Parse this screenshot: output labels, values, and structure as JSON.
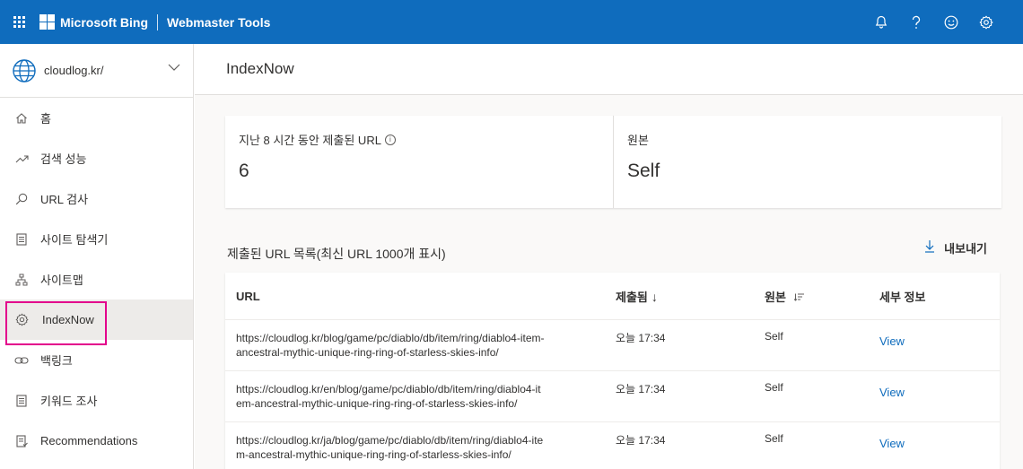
{
  "topbar": {
    "brand": "Microsoft Bing",
    "product": "Webmaster Tools",
    "icons": [
      "bell-icon",
      "help-icon",
      "smiley-icon",
      "settings-icon"
    ]
  },
  "sidebar": {
    "site": "cloudlog.kr/",
    "items": [
      {
        "label": "홈",
        "icon": "home-icon"
      },
      {
        "label": "검색 성능",
        "icon": "trend-icon"
      },
      {
        "label": "URL 검사",
        "icon": "search-icon"
      },
      {
        "label": "사이트 탐색기",
        "icon": "document-icon"
      },
      {
        "label": "사이트맵",
        "icon": "sitemap-icon"
      },
      {
        "label": "IndexNow",
        "icon": "gear-icon",
        "active": true
      },
      {
        "label": "백링크",
        "icon": "link-icon"
      },
      {
        "label": "키워드 조사",
        "icon": "document-icon"
      },
      {
        "label": "Recommendations",
        "icon": "checklist-icon"
      }
    ]
  },
  "page": {
    "title": "IndexNow"
  },
  "stats": {
    "submitted_label": "지난 8 시간 동안 제출된 URL",
    "submitted_value": "6",
    "source_label": "원본",
    "source_value": "Self"
  },
  "list": {
    "title": "제출된 URL 목록(최신 URL 1000개 표시)",
    "export_label": "내보내기",
    "columns": {
      "url": "URL",
      "submitted": "제출됨",
      "source": "원본",
      "details": "세부 정보"
    },
    "rows": [
      {
        "url": "https://cloudlog.kr/blog/game/pc/diablo/db/item/ring/diablo4-item-ancestral-mythic-unique-ring-ring-of-starless-skies-info/",
        "url_line1": "https://cloudlog.kr/blog/game/pc/diablo/db/item/ring/diablo4-item-",
        "url_line2": "ancestral-mythic-unique-ring-ring-of-starless-skies-info/",
        "submitted": "오늘 17:34",
        "source": "Self",
        "details": "View"
      },
      {
        "url": "https://cloudlog.kr/en/blog/game/pc/diablo/db/item/ring/diablo4-item-ancestral-mythic-unique-ring-ring-of-starless-skies-info/",
        "url_line1": "https://cloudlog.kr/en/blog/game/pc/diablo/db/item/ring/diablo4-it",
        "url_line2": "em-ancestral-mythic-unique-ring-ring-of-starless-skies-info/",
        "submitted": "오늘 17:34",
        "source": "Self",
        "details": "View"
      },
      {
        "url": "https://cloudlog.kr/ja/blog/game/pc/diablo/db/item/ring/diablo4-item-ancestral-mythic-unique-ring-ring-of-starless-skies-info/",
        "url_line1": "https://cloudlog.kr/ja/blog/game/pc/diablo/db/item/ring/diablo4-ite",
        "url_line2": "m-ancestral-mythic-unique-ring-ring-of-starless-skies-info/",
        "submitted": "오늘 17:34",
        "source": "Self",
        "details": "View"
      }
    ]
  },
  "colors": {
    "brand_blue": "#0f6cbd",
    "highlight": "#e3008c"
  }
}
